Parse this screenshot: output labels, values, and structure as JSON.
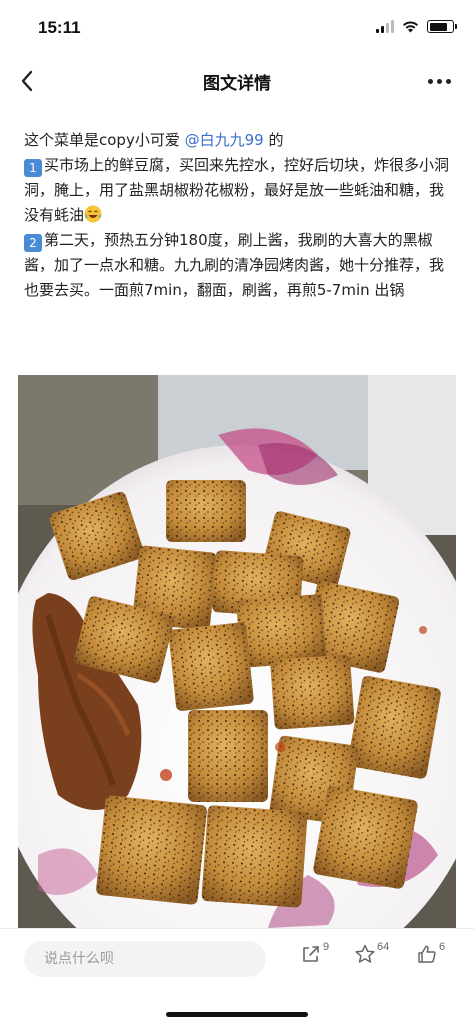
{
  "status_bar": {
    "time": "15:11"
  },
  "nav": {
    "title": "图文详情"
  },
  "post": {
    "intro_prefix": "这个菜单是copy小可爱 ",
    "mention": "@白九九99",
    "intro_suffix": " 的",
    "step1_number": "1",
    "step1_text": "买市场上的鲜豆腐，买回来先控水，控好后切块，炸很多小洞洞，腌上，用了盐黑胡椒粉花椒粉，最好是放一些蚝油和糖，我没有蚝油",
    "step2_number": "2",
    "step2_text": "第二天，预热五分钟180度，刷上酱，我刷的大喜大的黑椒酱，加了一点水和糖。九九刷的清净园烤肉酱，她十分推荐，我也要去买。一面煎7min，翻面，刷酱，再煎5-7min 出锅"
  },
  "bottom_bar": {
    "comment_placeholder": "说点什么呗",
    "share_count": "9",
    "favorite_count": "64",
    "like_count": "6"
  },
  "icons": {
    "back": "chevron-left-icon",
    "more": "ellipsis-icon",
    "share": "share-icon",
    "favorite": "star-icon",
    "like": "thumbs-up-icon"
  },
  "colors": {
    "mention": "#3a6dcb",
    "number_emoji": "#4a8bd6"
  }
}
